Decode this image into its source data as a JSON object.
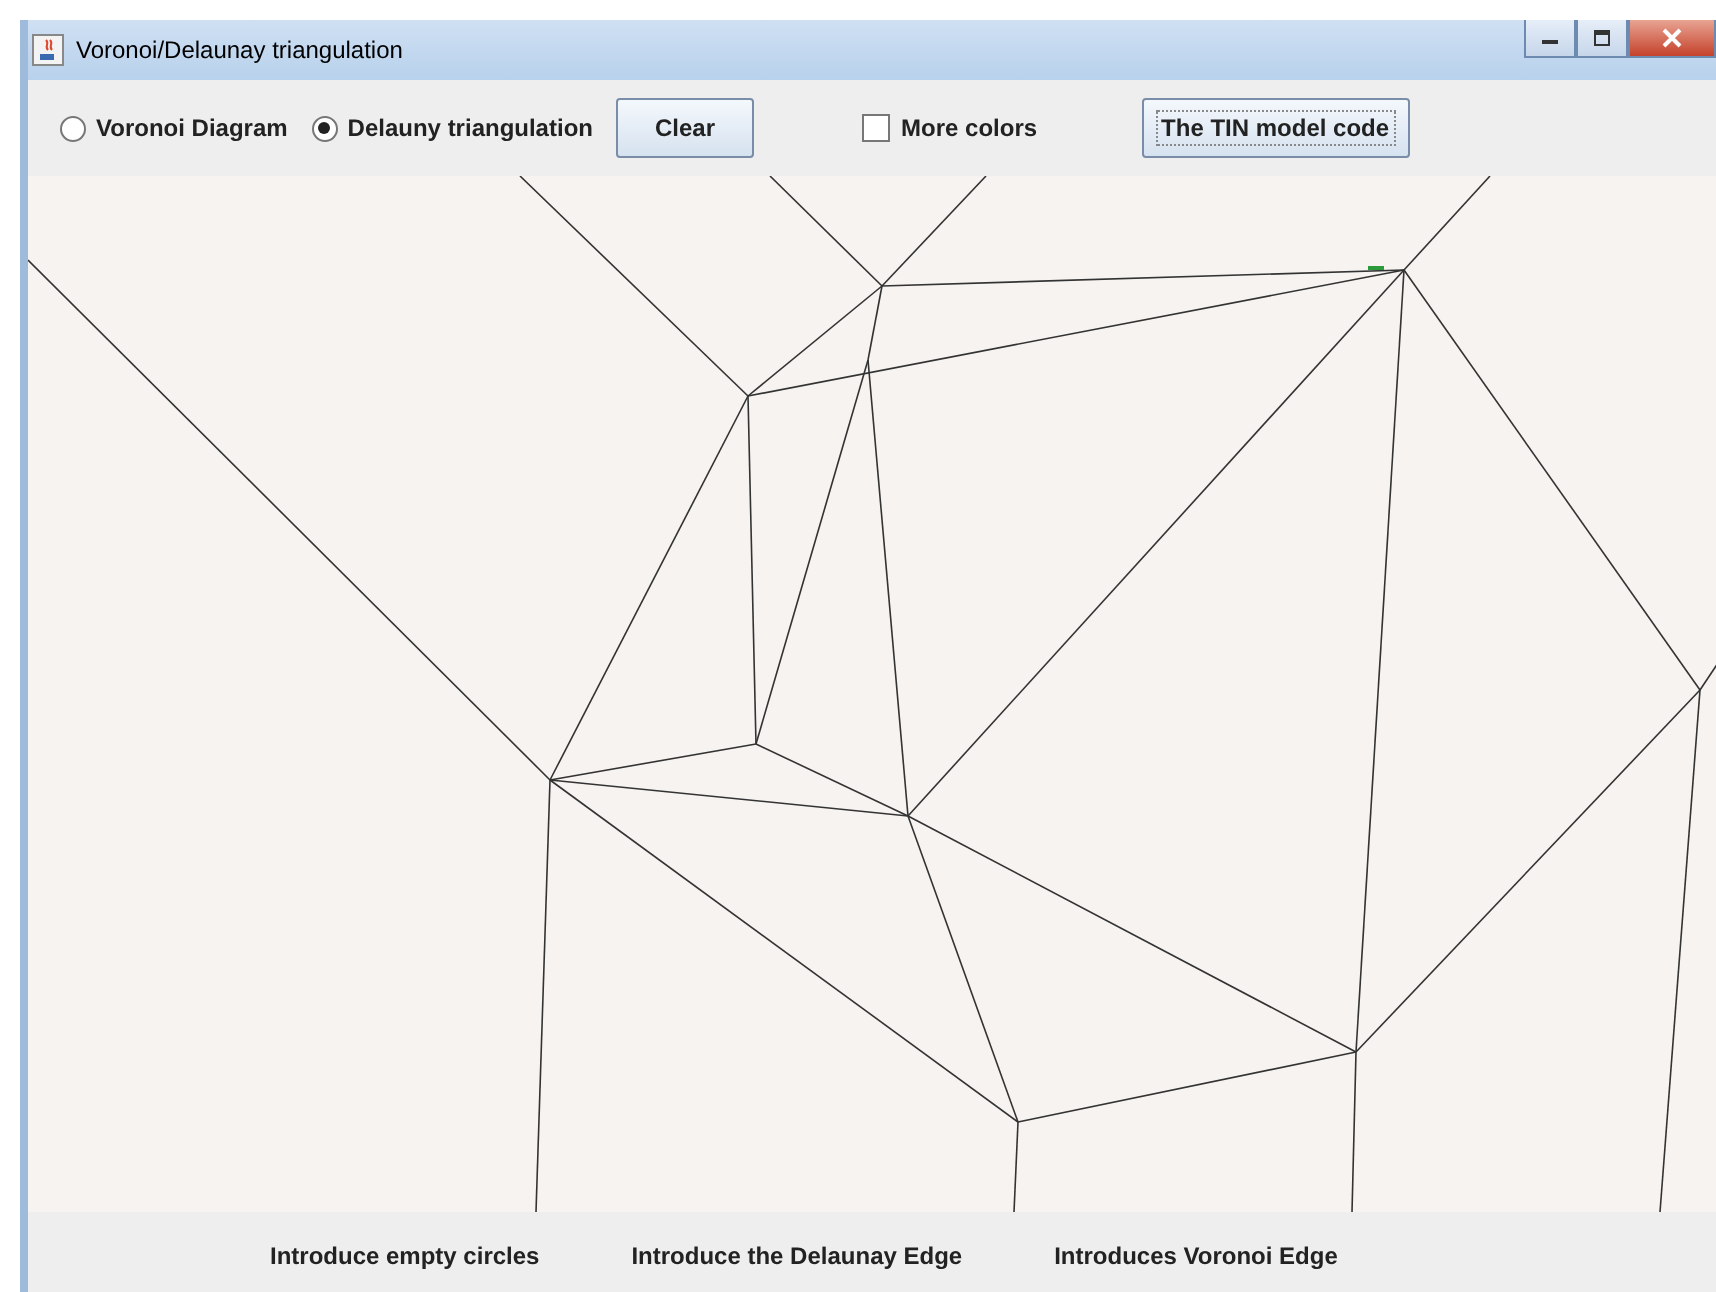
{
  "window": {
    "title": "Voronoi/Delaunay triangulation"
  },
  "toolbar": {
    "modes": [
      {
        "label": "Voronoi Diagram",
        "selected": false
      },
      {
        "label": "Delauny triangulation",
        "selected": true
      }
    ],
    "clear_button": "Clear",
    "more_colors": {
      "label": "More colors",
      "checked": false
    },
    "tin_button": "The TIN model code"
  },
  "bottom_buttons": [
    "Introduce empty circles",
    "Introduce the Delaunay Edge",
    "Introduces Voronoi Edge"
  ]
}
